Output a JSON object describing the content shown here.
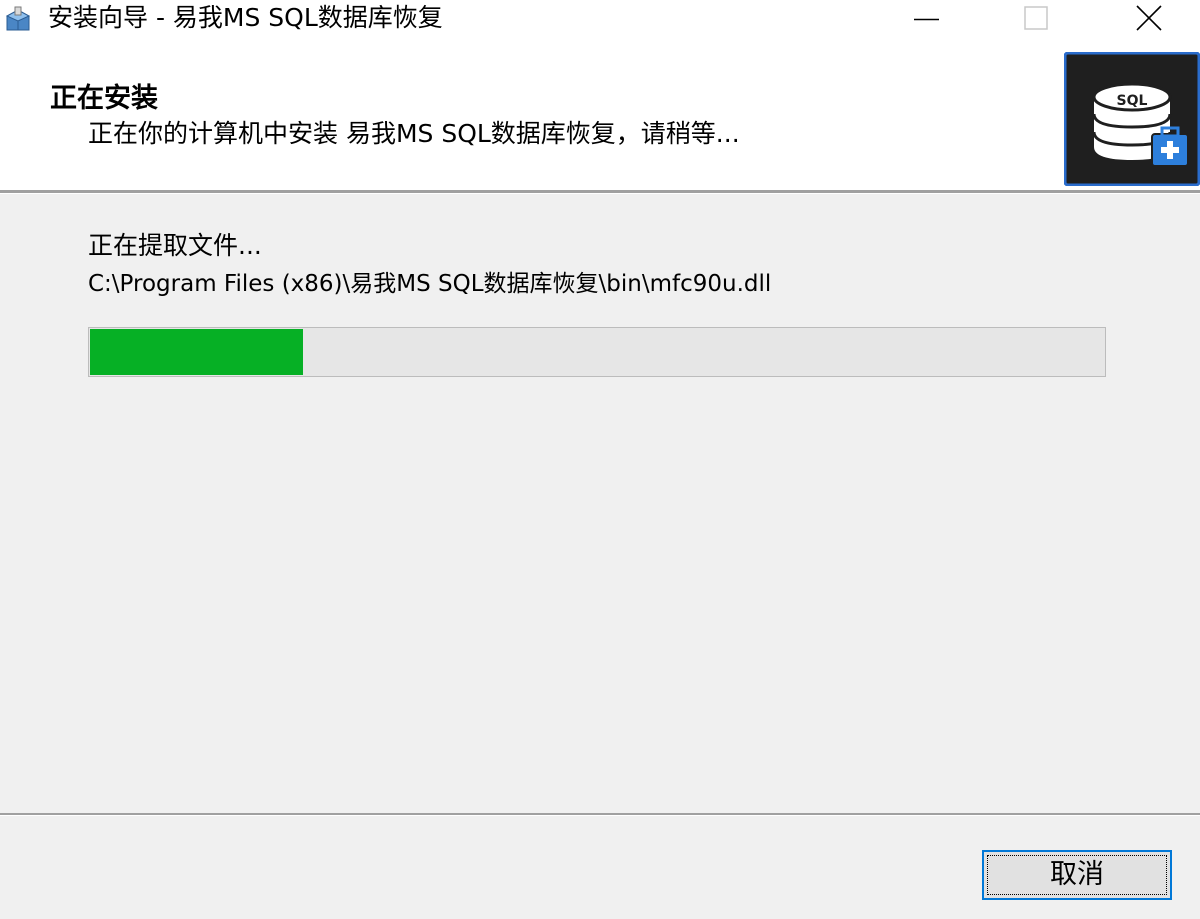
{
  "window": {
    "title": "安装向导 - 易我MS SQL数据库恢复",
    "icons": {
      "app": "installer-box-icon",
      "minimize": "minimize-icon",
      "maximize": "maximize-icon",
      "close": "close-icon"
    }
  },
  "header": {
    "title": "正在安装",
    "subtitle": "正在你的计算机中安装 易我MS SQL数据库恢复，请稍等...",
    "logo_icon": "sql-database-icon",
    "logo_text": "SQL"
  },
  "body": {
    "status": "正在提取文件...",
    "current_file": "C:\\Program Files (x86)\\易我MS SQL数据库恢复\\bin\\mfc90u.dll",
    "progress_fraction": 0.21
  },
  "footer": {
    "cancel_label": "取消"
  },
  "colors": {
    "progress_fill": "#06b025",
    "focus_border": "#0078d7",
    "logo_bg": "#1f1f1f",
    "logo_border": "#2a6ccc"
  }
}
